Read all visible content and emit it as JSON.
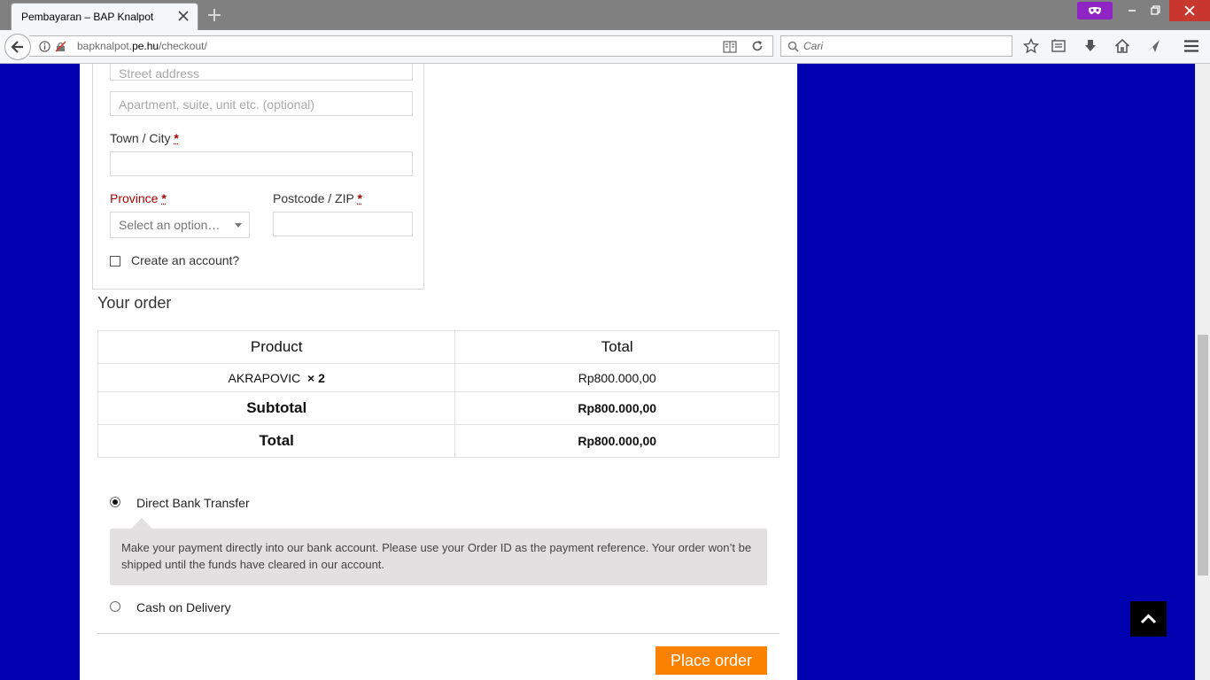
{
  "browser": {
    "tab_title": "Pembayaran – BAP Knalpot",
    "url_prefix": "bapknalpot.",
    "url_host": "pe.hu",
    "url_path": "/checkout/",
    "search_placeholder": "Cari"
  },
  "billing": {
    "street_placeholder": "Street address",
    "apartment_placeholder": "Apartment, suite, unit etc. (optional)",
    "town_label": "Town / City",
    "province_label": "Province",
    "province_select": "Select an option…",
    "postcode_label": "Postcode / ZIP",
    "required_mark": "*",
    "create_account_label": "Create an account?"
  },
  "order": {
    "title": "Your order",
    "columns": [
      "Product",
      "Total"
    ],
    "item": {
      "name": "AKRAPOVIC",
      "qty": "× 2",
      "total": "Rp800.000,00"
    },
    "subtotal_label": "Subtotal",
    "subtotal_value": "Rp800.000,00",
    "total_label": "Total",
    "total_value": "Rp800.000,00"
  },
  "payment": {
    "bank_label": "Direct Bank Transfer",
    "bank_description": "Make your payment directly into our bank account. Please use your Order ID as the payment reference. Your order won’t be shipped until the funds have cleared in our account.",
    "cod_label": "Cash on Delivery",
    "place_order": "Place order"
  },
  "colors": {
    "page_background": "#0000b0",
    "button_orange": "#fb8200",
    "error_red": "#aa0000",
    "private_mask": "#8e25c4"
  }
}
